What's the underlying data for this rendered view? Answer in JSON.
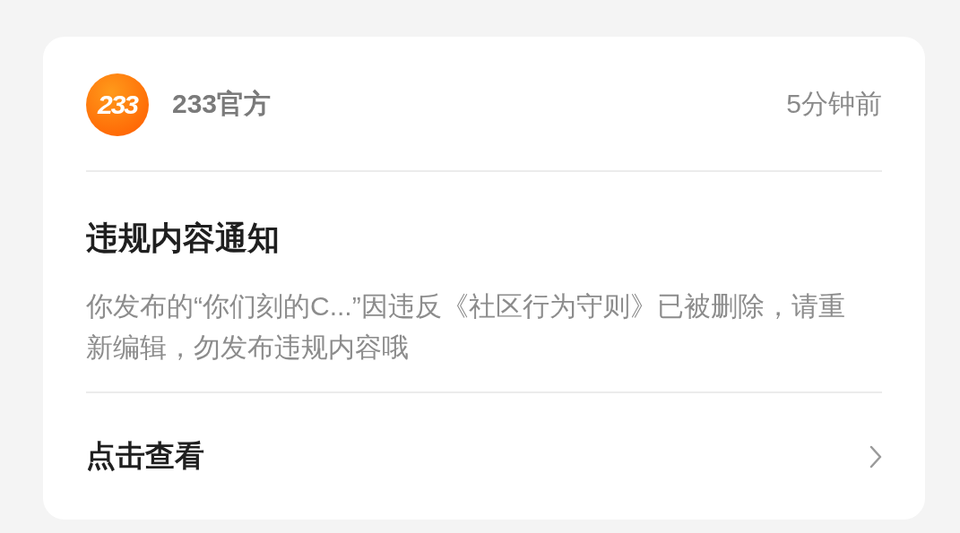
{
  "sender": {
    "logo_text": "233",
    "name": "233官方",
    "time": "5分钟前"
  },
  "notice": {
    "title": "违规内容通知",
    "body": "你发布的“你们刻的C...”因违反《社区行为守则》已被删除，请重新编辑，勿发布违规内容哦"
  },
  "action": {
    "label": "点击查看"
  }
}
